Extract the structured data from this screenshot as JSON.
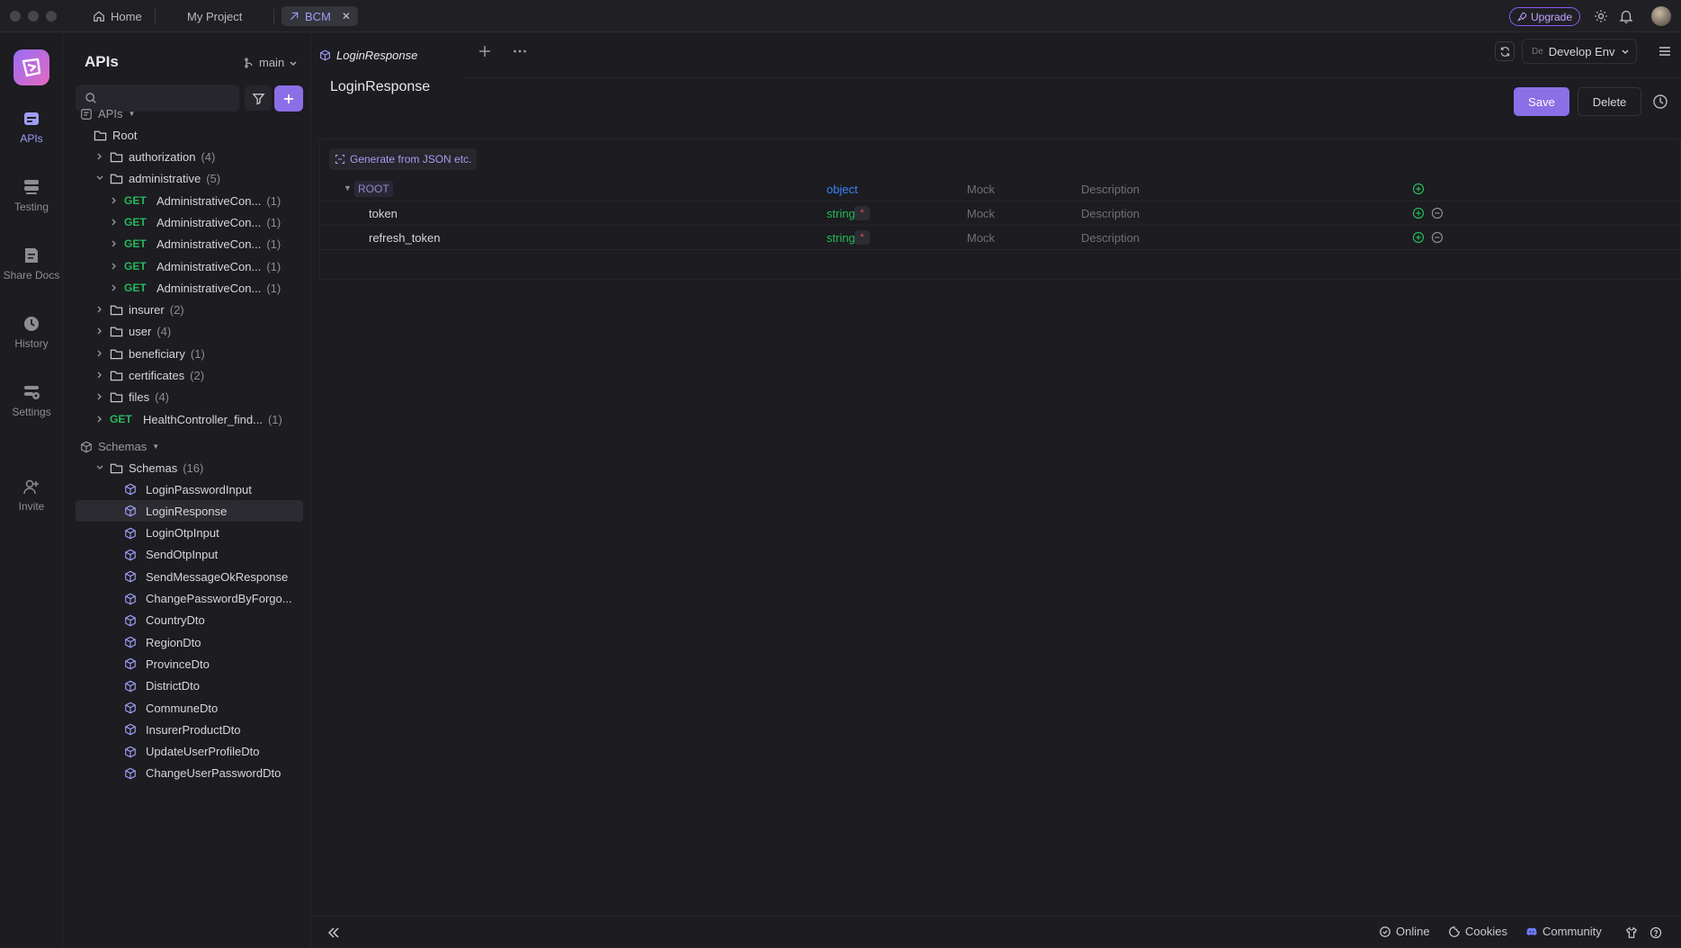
{
  "titlebar": {
    "tabs": [
      {
        "label": "Home"
      },
      {
        "label": "My Project"
      },
      {
        "label": "BCM"
      }
    ],
    "upgrade_label": "Upgrade"
  },
  "rail": {
    "items": [
      {
        "label": "APIs",
        "icon": "apis-icon",
        "active": true
      },
      {
        "label": "Testing",
        "icon": "testing-icon"
      },
      {
        "label": "Share Docs",
        "icon": "share-docs-icon"
      },
      {
        "label": "History",
        "icon": "history-icon"
      },
      {
        "label": "Settings",
        "icon": "settings-icon"
      },
      {
        "label": "Invite",
        "icon": "invite-icon"
      }
    ]
  },
  "sidebar": {
    "title": "APIs",
    "branch": "main",
    "apis_section": "APIs",
    "root": "Root",
    "folders": [
      {
        "name": "authorization",
        "count": "(4)",
        "expanded": false
      },
      {
        "name": "administrative",
        "count": "(5)",
        "expanded": true
      }
    ],
    "admin_endpoints": [
      {
        "method": "GET",
        "name": "AdministrativeCon...",
        "count": "(1)"
      },
      {
        "method": "GET",
        "name": "AdministrativeCon...",
        "count": "(1)"
      },
      {
        "method": "GET",
        "name": "AdministrativeCon...",
        "count": "(1)"
      },
      {
        "method": "GET",
        "name": "AdministrativeCon...",
        "count": "(1)"
      },
      {
        "method": "GET",
        "name": "AdministrativeCon...",
        "count": "(1)"
      }
    ],
    "more_folders": [
      {
        "name": "insurer",
        "count": "(2)"
      },
      {
        "name": "user",
        "count": "(4)"
      },
      {
        "name": "beneficiary",
        "count": "(1)"
      },
      {
        "name": "certificates",
        "count": "(2)"
      },
      {
        "name": "files",
        "count": "(4)"
      }
    ],
    "health_endpoint": {
      "method": "GET",
      "name": "HealthController_find...",
      "count": "(1)"
    },
    "schemas_section": "Schemas",
    "schemas_folder": {
      "name": "Schemas",
      "count": "(16)"
    },
    "schemas": [
      "LoginPasswordInput",
      "LoginResponse",
      "LoginOtpInput",
      "SendOtpInput",
      "SendMessageOkResponse",
      "ChangePasswordByForgo...",
      "CountryDto",
      "RegionDto",
      "ProvinceDto",
      "DistrictDto",
      "CommuneDto",
      "InsurerProductDto",
      "UpdateUserProfileDto",
      "ChangeUserPasswordDto"
    ],
    "active_schema": "LoginResponse"
  },
  "main": {
    "tab_label": "LoginResponse",
    "env_badge": "De",
    "env_label": "Develop Env",
    "title": "LoginResponse",
    "save_label": "Save",
    "delete_label": "Delete",
    "generate_label": "Generate from JSON etc.",
    "fields": [
      {
        "name": "ROOT",
        "type": "object",
        "required": false,
        "mock": "Mock",
        "description": "Description",
        "type_color": "#3b82f6"
      },
      {
        "name": "token",
        "type": "string",
        "required": true,
        "mock": "Mock",
        "description": "Description",
        "type_color": "#26b85a"
      },
      {
        "name": "refresh_token",
        "type": "string",
        "required": true,
        "mock": "Mock",
        "description": "Description",
        "type_color": "#26b85a"
      }
    ]
  },
  "statusbar": {
    "online": "Online",
    "cookies": "Cookies",
    "community": "Community"
  },
  "colors": {
    "accent": "#8b6fe6",
    "get_method": "#26b85a"
  }
}
